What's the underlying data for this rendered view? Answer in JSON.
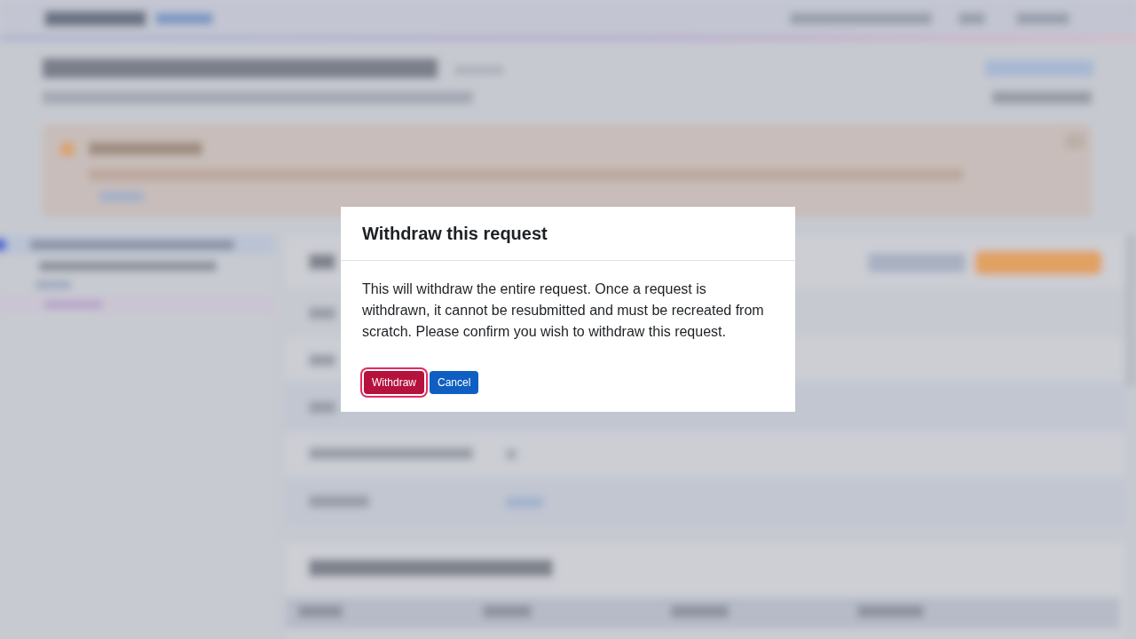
{
  "dialog": {
    "title": "Withdraw this request",
    "message": "This will withdraw the entire request. Once a request is withdrawn, it cannot be resubmitted and must be recreated from scratch. Please confirm you wish to withdraw this request.",
    "buttons": [
      {
        "label": "Withdraw",
        "kind": "danger",
        "focused": true
      },
      {
        "label": "Cancel",
        "kind": "primary",
        "focused": false
      }
    ]
  }
}
